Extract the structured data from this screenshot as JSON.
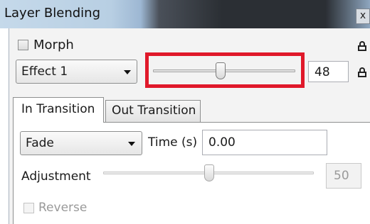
{
  "window": {
    "title": "Layer Blending",
    "close_glyph": "x"
  },
  "morph": {
    "label": "Morph",
    "checked": false
  },
  "effect": {
    "selected": "Effect 1",
    "slider_value": 0.48,
    "value_text": "48"
  },
  "tabs": [
    {
      "label": "In Transition",
      "active": true
    },
    {
      "label": "Out Transition",
      "active": false
    }
  ],
  "transition": {
    "type_selected": "Fade",
    "time_label": "Time (s)",
    "time_value": "0.00",
    "adjustment_label": "Adjustment",
    "adjustment_slider_value": 0.5,
    "adjustment_value_text": "50",
    "reverse_label": "Reverse",
    "reverse_checked": false
  },
  "colors": {
    "highlight": "#e0192a"
  }
}
